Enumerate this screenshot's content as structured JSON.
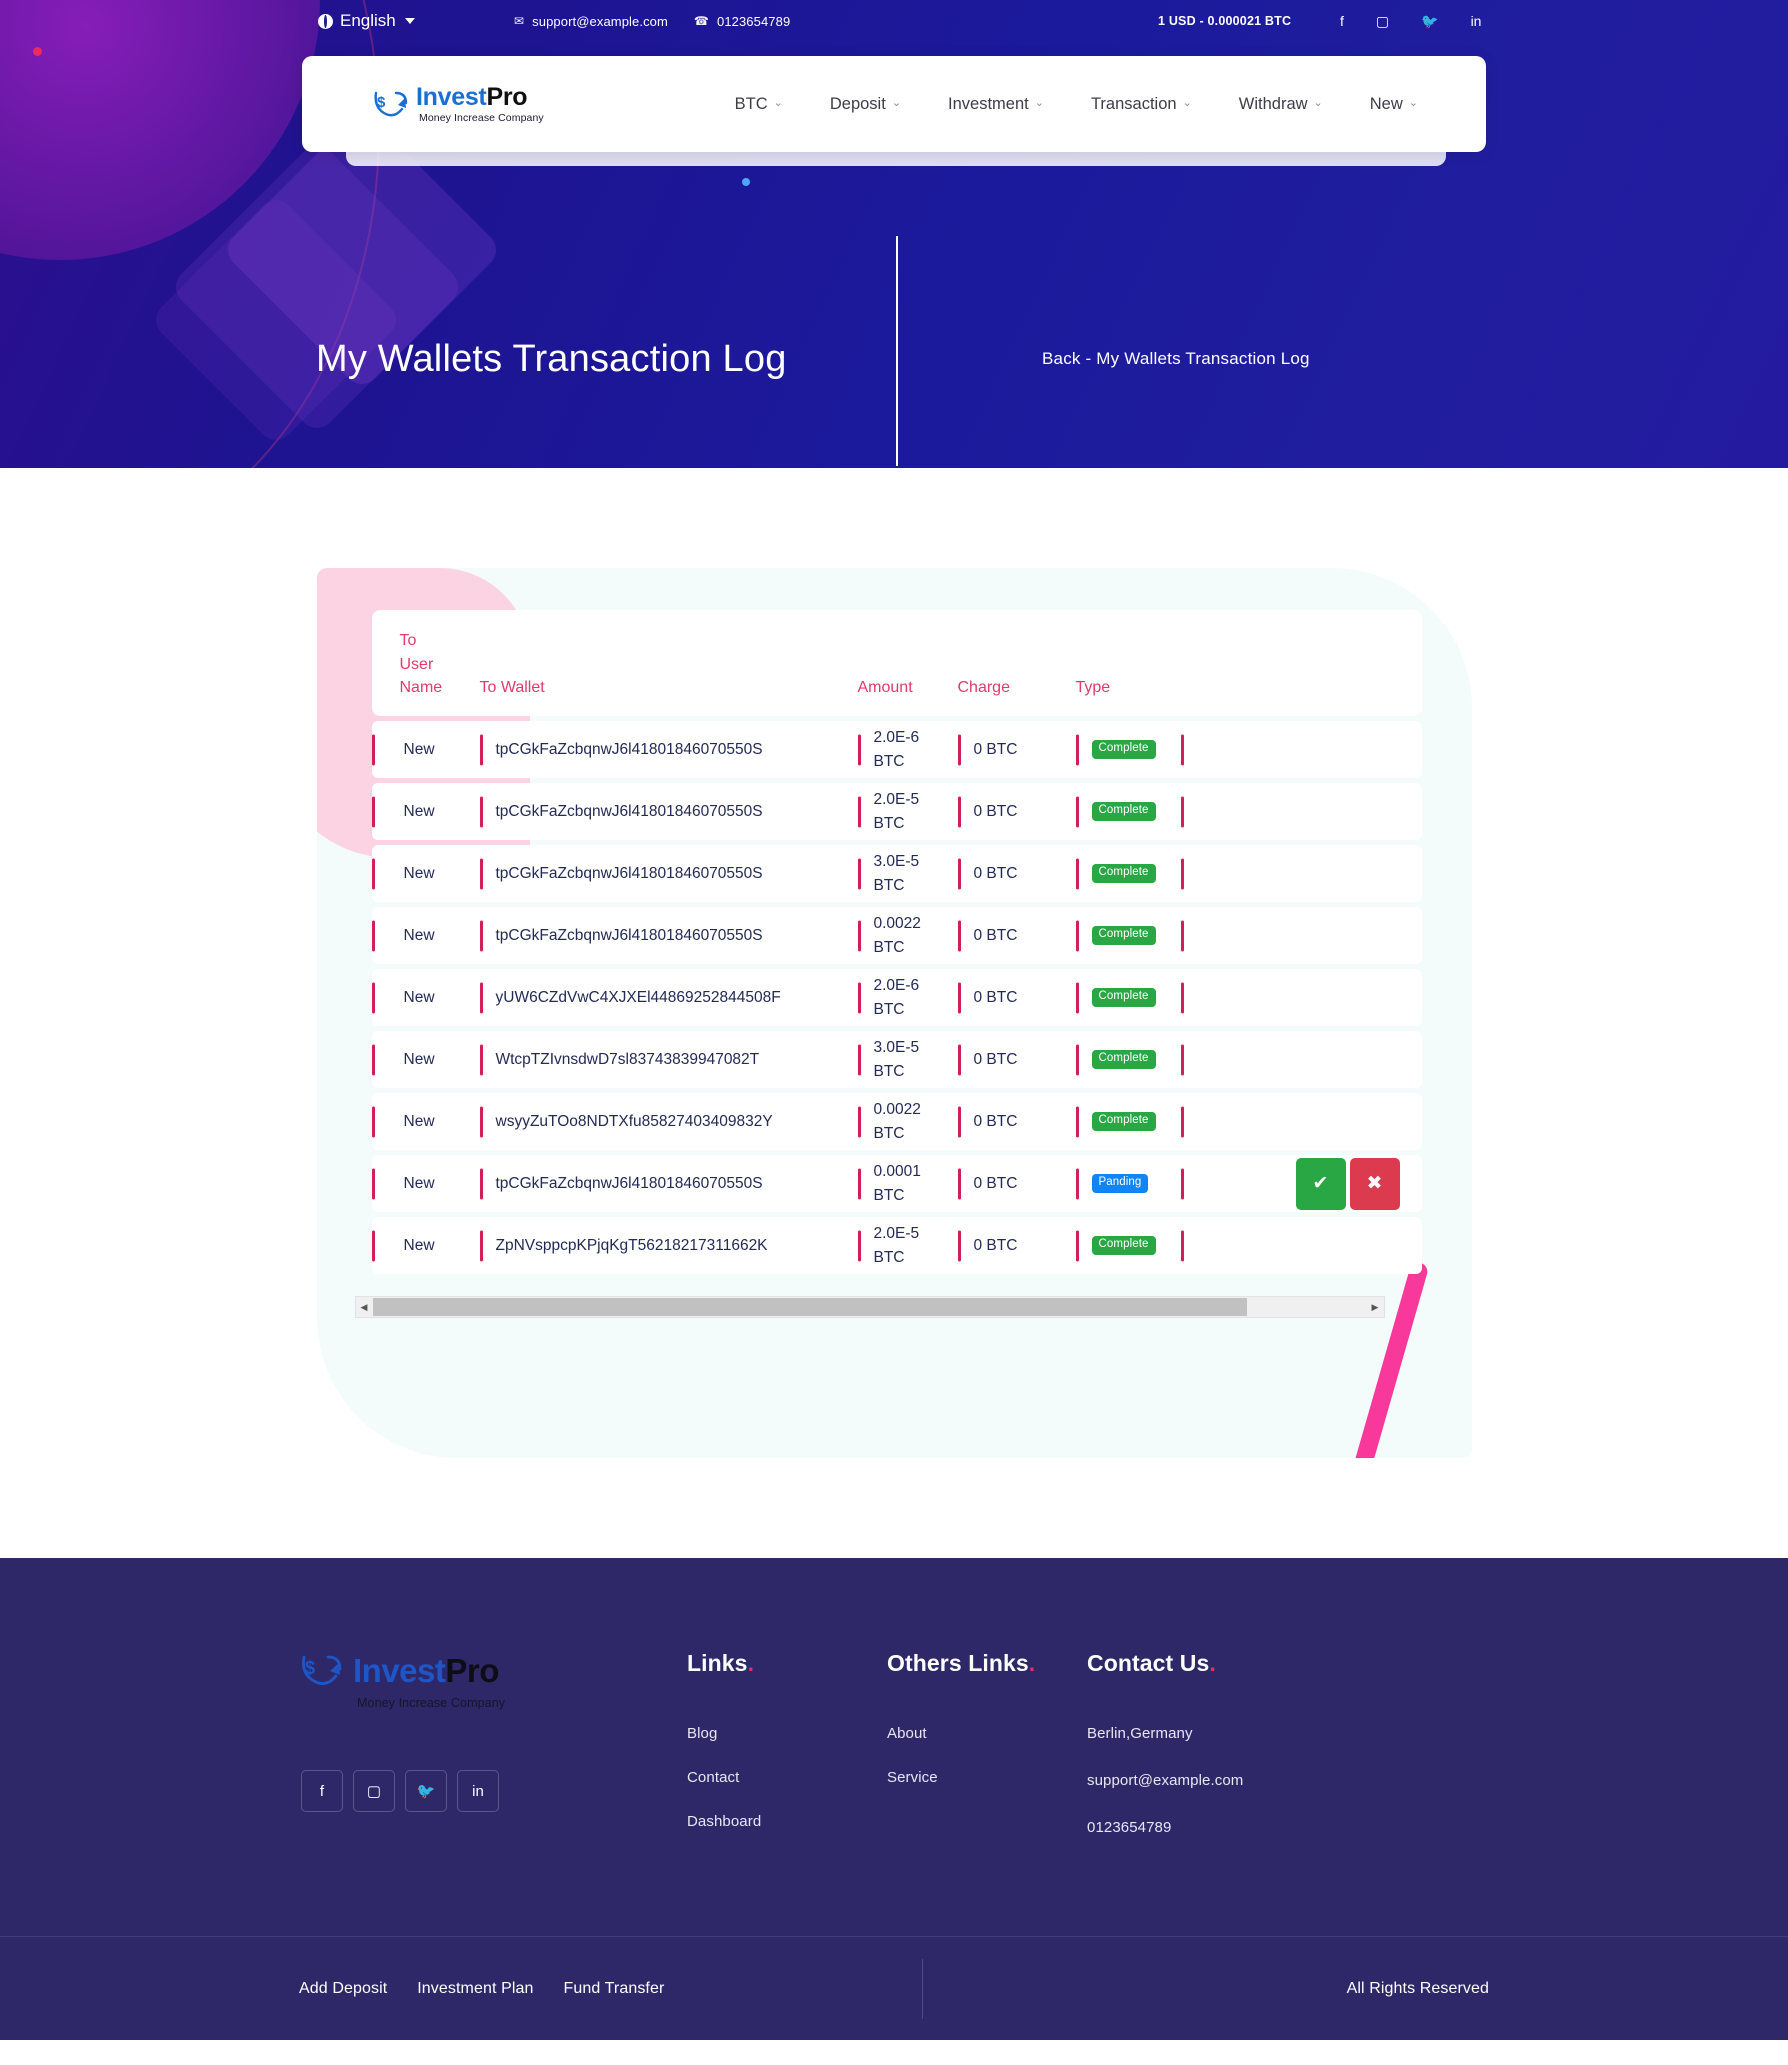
{
  "topbar": {
    "language": "English",
    "language_icon": "globe-icon",
    "email": "support@example.com",
    "email_icon": "envelope-icon",
    "phone": "0123654789",
    "phone_icon": "phone-icon",
    "rate": "1 USD - 0.000021 BTC",
    "social": [
      {
        "name": "facebook-icon",
        "glyph": "f"
      },
      {
        "name": "instagram-icon",
        "glyph": "▢"
      },
      {
        "name": "twitter-icon",
        "glyph": "🐦"
      },
      {
        "name": "linkedin-icon",
        "glyph": "in"
      }
    ]
  },
  "brand": {
    "name_part1": "Invest",
    "name_part2": "Pro",
    "tagline": "Money Increase Company"
  },
  "nav": {
    "items": [
      {
        "label": "BTC",
        "chevron": "⌄"
      },
      {
        "label": "Deposit",
        "chevron": "⌄"
      },
      {
        "label": "Investment",
        "chevron": "⌄"
      },
      {
        "label": "Transaction",
        "chevron": "⌄"
      },
      {
        "label": "Withdraw",
        "chevron": "⌄"
      },
      {
        "label": "New",
        "chevron": "⌄"
      }
    ]
  },
  "hero": {
    "title": "My Wallets Transaction Log",
    "breadcrumb": "Back - My Wallets Transaction Log"
  },
  "table": {
    "columns": {
      "username": "To\nUser\nName",
      "username_l1": "To",
      "username_l2": "User",
      "username_l3": "Name",
      "wallet": "To Wallet",
      "amount": "Amount",
      "charge": "Charge",
      "type": "Type",
      "action": ""
    },
    "rows": [
      {
        "username": "New",
        "wallet": "tpCGkFaZcbqnwJ6l41801846070550S",
        "amount": "2.0E-6",
        "amount_unit": "BTC",
        "charge": "0 BTC",
        "type": "Complete",
        "type_style": "complete",
        "actions": false
      },
      {
        "username": "New",
        "wallet": "tpCGkFaZcbqnwJ6l41801846070550S",
        "amount": "2.0E-5",
        "amount_unit": "BTC",
        "charge": "0 BTC",
        "type": "Complete",
        "type_style": "complete",
        "actions": false
      },
      {
        "username": "New",
        "wallet": "tpCGkFaZcbqnwJ6l41801846070550S",
        "amount": "3.0E-5",
        "amount_unit": "BTC",
        "charge": "0 BTC",
        "type": "Complete",
        "type_style": "complete",
        "actions": false
      },
      {
        "username": "New",
        "wallet": "tpCGkFaZcbqnwJ6l41801846070550S",
        "amount": "0.0022",
        "amount_unit": "BTC",
        "charge": "0 BTC",
        "type": "Complete",
        "type_style": "complete",
        "actions": false
      },
      {
        "username": "New",
        "wallet": "yUW6CZdVwC4XJXEl44869252844508F",
        "amount": "2.0E-6",
        "amount_unit": "BTC",
        "charge": "0 BTC",
        "type": "Complete",
        "type_style": "complete",
        "actions": false
      },
      {
        "username": "New",
        "wallet": "WtcpTZIvnsdwD7sl83743839947082T",
        "amount": "3.0E-5",
        "amount_unit": "BTC",
        "charge": "0 BTC",
        "type": "Complete",
        "type_style": "complete",
        "actions": false
      },
      {
        "username": "New",
        "wallet": "wsyyZuTOo8NDTXfu85827403409832Y",
        "amount": "0.0022",
        "amount_unit": "BTC",
        "charge": "0 BTC",
        "type": "Complete",
        "type_style": "complete",
        "actions": false
      },
      {
        "username": "New",
        "wallet": "tpCGkFaZcbqnwJ6l41801846070550S",
        "amount": "0.0001",
        "amount_unit": "BTC",
        "charge": "0 BTC",
        "type": "Panding",
        "type_style": "panding",
        "actions": true
      },
      {
        "username": "New",
        "wallet": "ZpNVsppcpKPjqKgT56218217311662K",
        "amount": "2.0E-5",
        "amount_unit": "BTC",
        "charge": "0 BTC",
        "type": "Complete",
        "type_style": "complete",
        "actions": false
      }
    ],
    "row_actions": {
      "approve_glyph": "✔",
      "approve_name": "approve-button",
      "reject_glyph": "✖",
      "reject_name": "reject-button"
    },
    "scrollbar": {
      "left_arrow": "◀",
      "right_arrow": "▶"
    }
  },
  "footer": {
    "brand": {
      "name_part1": "Invest",
      "name_part2": "Pro",
      "tagline": "Money Increase Company"
    },
    "social": [
      {
        "name": "facebook-icon",
        "glyph": "f"
      },
      {
        "name": "instagram-icon",
        "glyph": "▢"
      },
      {
        "name": "twitter-icon",
        "glyph": "🐦"
      },
      {
        "name": "linkedin-icon",
        "glyph": "in"
      }
    ],
    "links_heading": "Links",
    "links": [
      "Blog",
      "Contact",
      "Dashboard"
    ],
    "others_heading": "Others Links",
    "others": [
      "About",
      "Service"
    ],
    "contact_heading": "Contact Us",
    "contact": [
      "Berlin,Germany",
      "support@example.com",
      "0123654789"
    ],
    "bottom_links": [
      "Add Deposit",
      "Investment Plan",
      "Fund Transfer"
    ],
    "rights": "All Rights Reserved",
    "heading_dot": "."
  },
  "colors": {
    "hero_bg": "#1b1a9c",
    "accent_pink": "#e23a6a",
    "accent_bar": "#d21f57",
    "badge_complete": "#2aa745",
    "badge_panding": "#1185f7",
    "approve": "#2aa745",
    "reject": "#dc3a4f",
    "footer_bg": "#2e2868",
    "card_bg": "#f3fcfb",
    "deco_pink": "#fcd3e2",
    "brand_blue": "#1a6fd4"
  }
}
